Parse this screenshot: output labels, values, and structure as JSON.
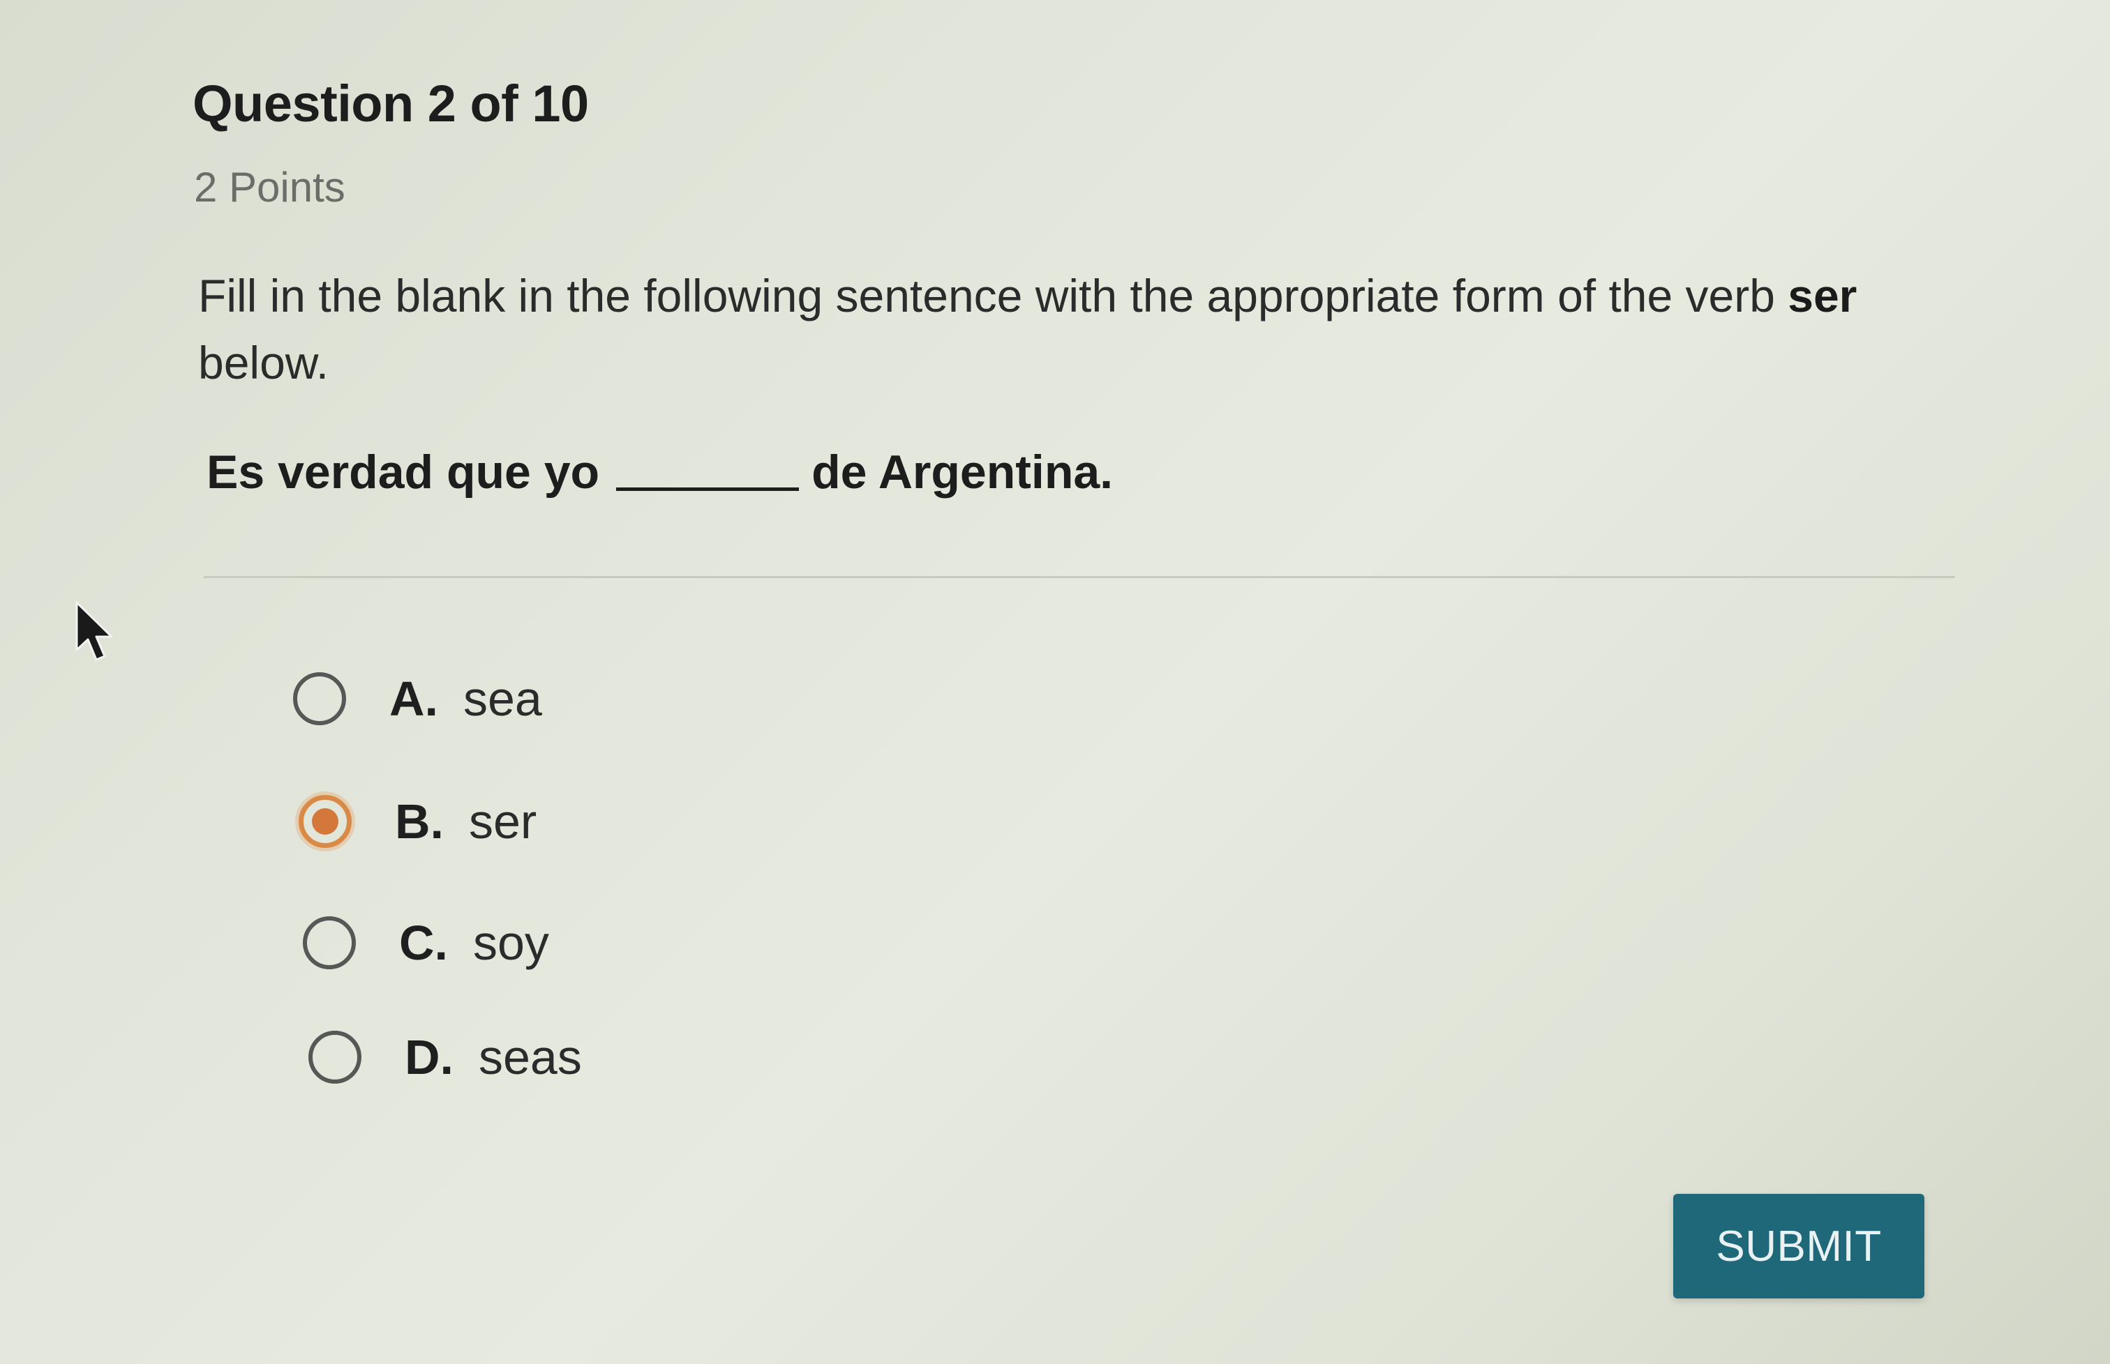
{
  "question": {
    "title": "Question 2 of 10",
    "points": "2 Points",
    "prompt_before": "Fill in the blank in the following sentence with the appropriate form of the verb ",
    "prompt_bold": "ser",
    "prompt_after": " below.",
    "sentence_before": "Es verdad que yo",
    "sentence_after": "de Argentina."
  },
  "options": [
    {
      "letter": "A.",
      "text": "sea",
      "selected": false
    },
    {
      "letter": "B.",
      "text": "ser",
      "selected": true
    },
    {
      "letter": "C.",
      "text": "soy",
      "selected": false
    },
    {
      "letter": "D.",
      "text": "seas",
      "selected": false
    }
  ],
  "submit_label": "SUBMIT",
  "colors": {
    "accent_selected": "#d98a47",
    "submit_bg": "#1f6879"
  }
}
